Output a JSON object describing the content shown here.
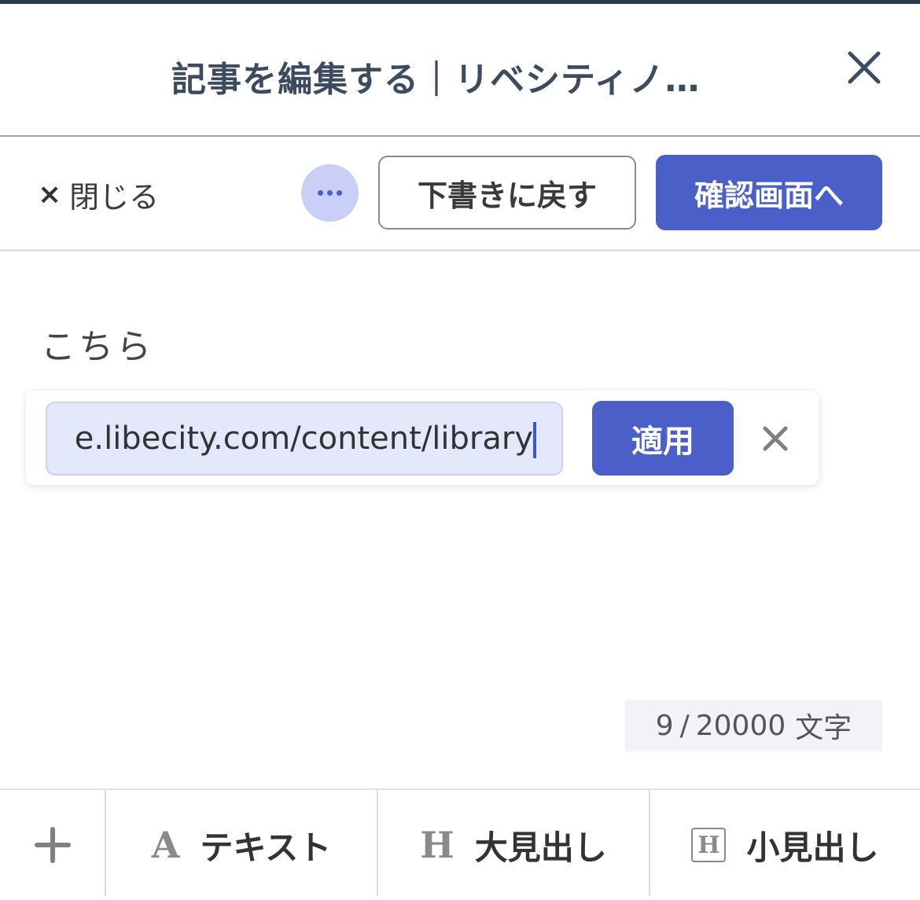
{
  "header": {
    "title": "記事を編集する｜リベシティノ…"
  },
  "toolbar": {
    "close_label": "閉じる",
    "close_icon": "×",
    "more_icon": "more-horizontal-icon",
    "draft_label": "下書きに戻す",
    "confirm_label": "確認画面へ"
  },
  "editor": {
    "body_text": "こちら",
    "link_popup": {
      "url_value": "e.libecity.com/content/library",
      "apply_label": "適用"
    }
  },
  "counter": {
    "current": "9",
    "separator": "/",
    "max": "20000",
    "unit": "文字"
  },
  "bottom_bar": {
    "text_glyph": "A",
    "text_label": "テキスト",
    "h1_glyph": "H",
    "h1_label": "大見出し",
    "h2_glyph": "H",
    "h2_label": "小見出し"
  },
  "colors": {
    "primary": "#4a5fc8",
    "title": "#3d4b60",
    "input_bg": "#e3e8fb"
  }
}
